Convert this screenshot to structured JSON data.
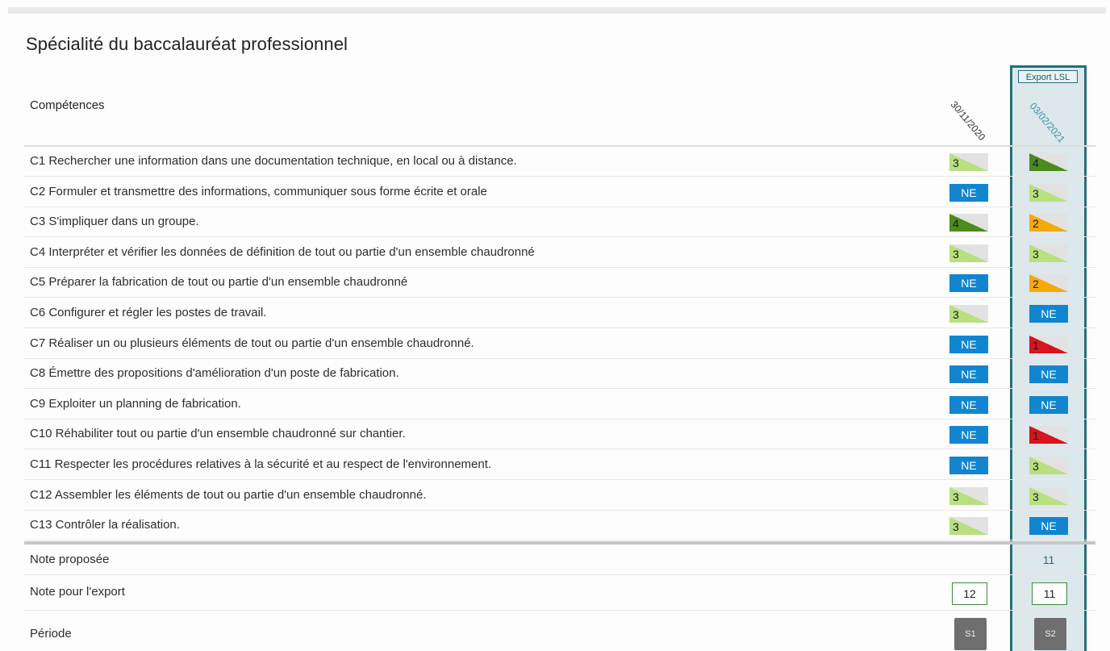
{
  "title": "Spécialité du baccalauréat professionnel",
  "header": {
    "competences_label": "Compétences",
    "dates": [
      "30/11/2020",
      "03/02/2021"
    ],
    "export_label": "Export LSL"
  },
  "competences": [
    {
      "label": "C1 Rechercher une information dans une documentation technique, en local ou à distance.",
      "eval1": "3",
      "eval2": "4"
    },
    {
      "label": "C2 Formuler et transmettre des informations, communiquer sous forme écrite et orale",
      "eval1": "NE",
      "eval2": "3"
    },
    {
      "label": "C3 S'impliquer dans un groupe.",
      "eval1": "4",
      "eval2": "2"
    },
    {
      "label": "C4 Interpréter et vérifier les données de définition de tout ou partie d'un ensemble chaudronné",
      "eval1": "3",
      "eval2": "3"
    },
    {
      "label": "C5 Préparer la fabrication de tout ou partie d'un ensemble chaudronné",
      "eval1": "NE",
      "eval2": "2"
    },
    {
      "label": "C6 Configurer et régler les postes de travail.",
      "eval1": "3",
      "eval2": "NE"
    },
    {
      "label": "C7 Réaliser un ou plusieurs éléments de tout ou partie d'un ensemble chaudronné.",
      "eval1": "NE",
      "eval2": "1"
    },
    {
      "label": "C8 Émettre des propositions d'amélioration d'un poste de fabrication.",
      "eval1": "NE",
      "eval2": "NE"
    },
    {
      "label": "C9 Exploiter un planning de fabrication.",
      "eval1": "NE",
      "eval2": "NE"
    },
    {
      "label": "C10 Réhabiliter tout ou partie d'un ensemble chaudronné sur chantier.",
      "eval1": "NE",
      "eval2": "1"
    },
    {
      "label": "C11 Respecter les procédures relatives à la sécurité et au respect de l'environnement.",
      "eval1": "NE",
      "eval2": "3"
    },
    {
      "label": "C12 Assembler les éléments de tout ou partie d'un ensemble chaudronné.",
      "eval1": "3",
      "eval2": "3"
    },
    {
      "label": "C13 Contrôler la réalisation.",
      "eval1": "3",
      "eval2": "NE"
    }
  ],
  "summary": {
    "note_proposee_label": "Note proposée",
    "note_proposee_value": "11",
    "note_export_label": "Note pour l'export",
    "note_export_values": [
      "12",
      "11"
    ],
    "periode_label": "Période",
    "periodes": [
      "S1",
      "S2"
    ]
  },
  "level_colors": {
    "1": "#d7141f",
    "2": "#f6a90a",
    "3": "#b8e07f",
    "4": "#4c8b1e",
    "NE": "#1185d0"
  }
}
